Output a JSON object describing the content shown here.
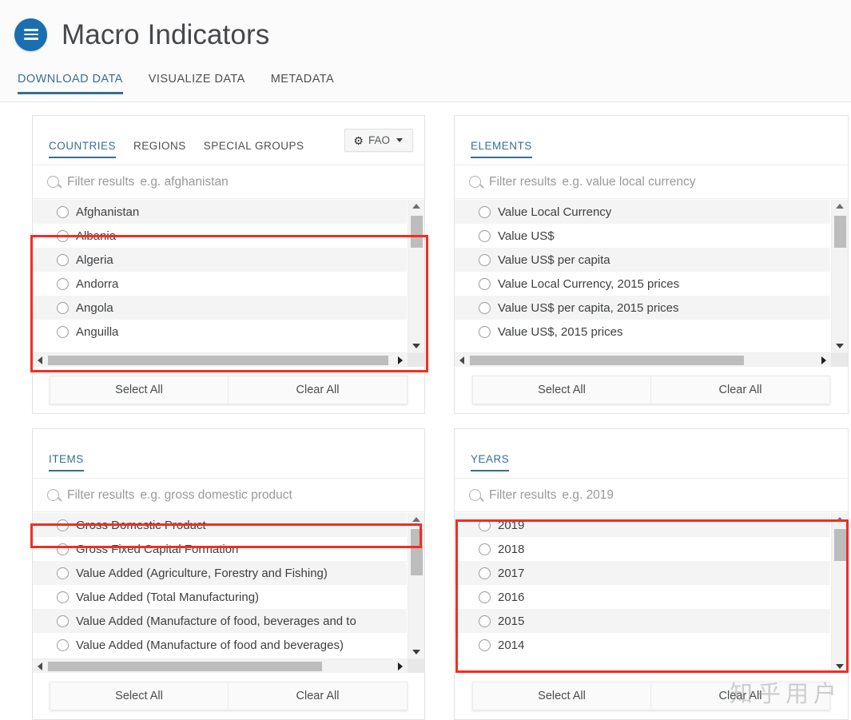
{
  "header": {
    "title": "Macro Indicators",
    "menu_icon": "hamburger-menu-icon"
  },
  "tabs": [
    {
      "label": "DOWNLOAD DATA",
      "active": true
    },
    {
      "label": "VISUALIZE DATA",
      "active": false
    },
    {
      "label": "METADATA",
      "active": false
    }
  ],
  "common": {
    "filter_label": "Filter results",
    "select_all": "Select All",
    "clear_all": "Clear All",
    "search_icon": "search-icon"
  },
  "panels": {
    "countries": {
      "tabs": [
        {
          "label": "COUNTRIES",
          "active": true
        },
        {
          "label": "REGIONS",
          "active": false
        },
        {
          "label": "SPECIAL GROUPS",
          "active": false
        }
      ],
      "source_button": {
        "label": "FAO",
        "icon": "gear-icon",
        "caret": "chevron-down-icon"
      },
      "filter_placeholder": "e.g. afghanistan",
      "items": [
        "Afghanistan",
        "Albania",
        "Algeria",
        "Andorra",
        "Angola",
        "Anguilla"
      ]
    },
    "elements": {
      "title": "ELEMENTS",
      "filter_placeholder": "e.g. value local currency",
      "items": [
        "Value Local Currency",
        "Value US$",
        "Value US$ per capita",
        "Value Local Currency, 2015 prices",
        "Value US$ per capita, 2015 prices",
        "Value US$, 2015 prices"
      ]
    },
    "items": {
      "title": "ITEMS",
      "filter_placeholder": "e.g. gross domestic product",
      "items": [
        "Gross Domestic Product",
        "Gross Fixed Capital Formation",
        "Value Added (Agriculture, Forestry and Fishing)",
        "Value Added (Total Manufacturing)",
        "Value Added (Manufacture of food, beverages and to",
        "Value Added (Manufacture of food and beverages)"
      ]
    },
    "years": {
      "title": "YEARS",
      "filter_placeholder": "e.g. 2019",
      "items": [
        "2019",
        "2018",
        "2017",
        "2016",
        "2015",
        "2014"
      ]
    }
  },
  "annotations": {
    "color": "#f12e22",
    "boxes": [
      "countries-list-highlight",
      "years-list-highlight",
      "gross-domestic-product-row-highlight"
    ]
  },
  "watermark": {
    "text": "知乎用户"
  }
}
